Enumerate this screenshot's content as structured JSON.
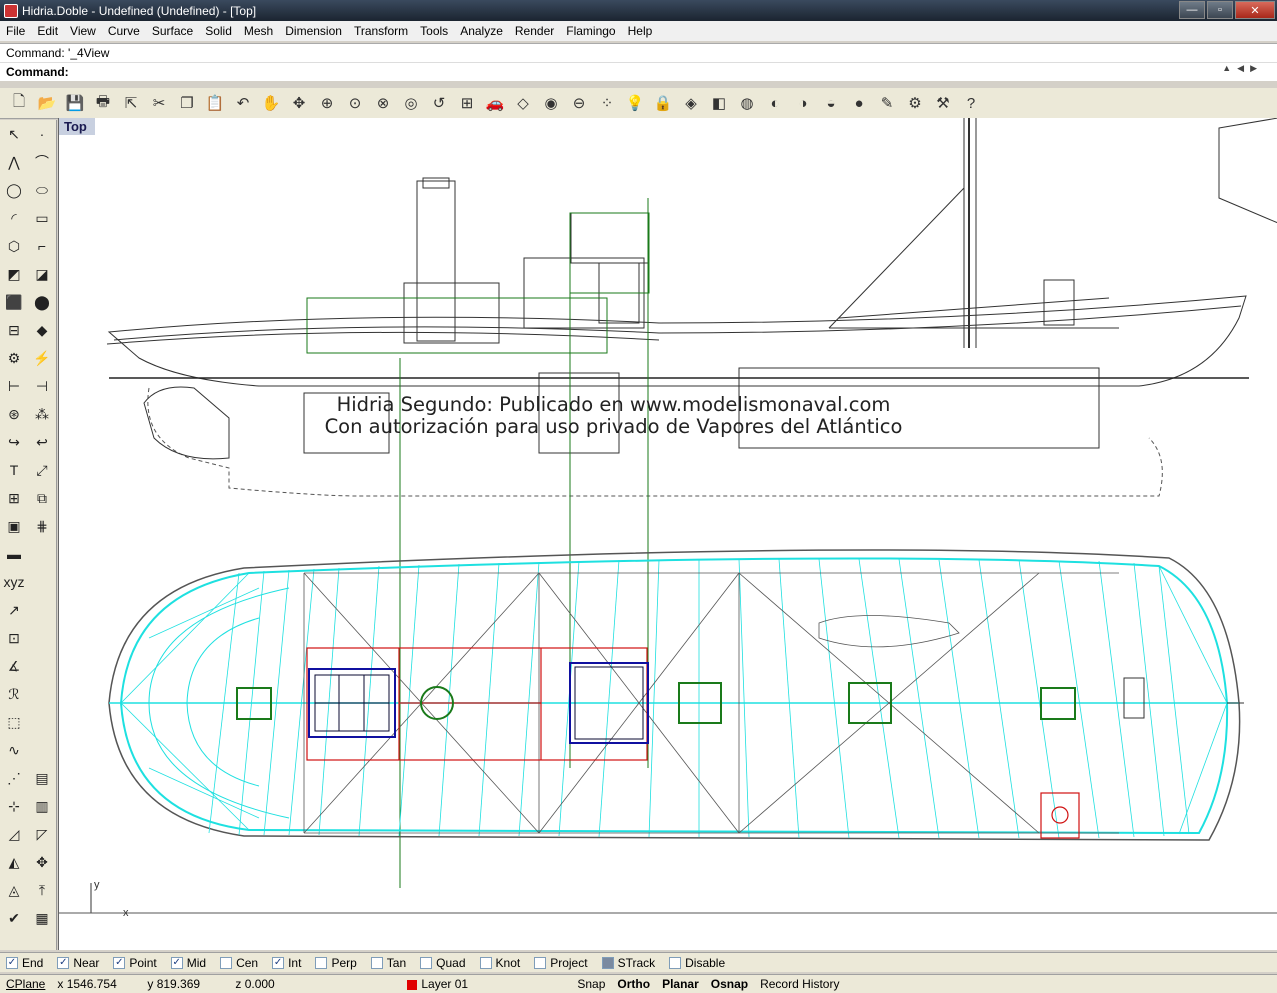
{
  "window": {
    "title": "Hidria.Doble - Undefined (Undefined) - [Top]",
    "min_glyph": "—",
    "max_glyph": "▫",
    "close_glyph": "✕"
  },
  "menu": [
    "File",
    "Edit",
    "View",
    "Curve",
    "Surface",
    "Solid",
    "Mesh",
    "Dimension",
    "Transform",
    "Tools",
    "Analyze",
    "Render",
    "Flamingo",
    "Help"
  ],
  "command": {
    "history": "Command: '_4View",
    "prompt": "Command:"
  },
  "viewport": {
    "label": "Top",
    "watermark_line1": "Hidria Segundo: Publicado en www.modelismonaval.com",
    "watermark_line2": "Con autorización para uso privado de Vapores del Atlántico",
    "axis_y": "y",
    "axis_x": "x"
  },
  "osnap": [
    {
      "label": "End",
      "checked": true
    },
    {
      "label": "Near",
      "checked": true
    },
    {
      "label": "Point",
      "checked": true
    },
    {
      "label": "Mid",
      "checked": true
    },
    {
      "label": "Cen",
      "checked": false
    },
    {
      "label": "Int",
      "checked": true
    },
    {
      "label": "Perp",
      "checked": false
    },
    {
      "label": "Tan",
      "checked": false
    },
    {
      "label": "Quad",
      "checked": false
    },
    {
      "label": "Knot",
      "checked": false
    },
    {
      "label": "Project",
      "checked": false
    },
    {
      "label": "STrack",
      "checked": false
    },
    {
      "label": "Disable",
      "checked": false
    }
  ],
  "status": {
    "cplane": "CPlane",
    "x": "x 1546.754",
    "y": "y 819.369",
    "z": "z 0.000",
    "layer": "Layer 01",
    "layer_color": "#e00000",
    "snap": "Snap",
    "ortho": "Ortho",
    "planar": "Planar",
    "osnap": "Osnap",
    "record_history": "Record History"
  },
  "colors": {
    "hull_lines": "#1ee0e0",
    "deck_red": "#d01010",
    "green": "#1a7a1a",
    "blue": "#1010a0"
  }
}
